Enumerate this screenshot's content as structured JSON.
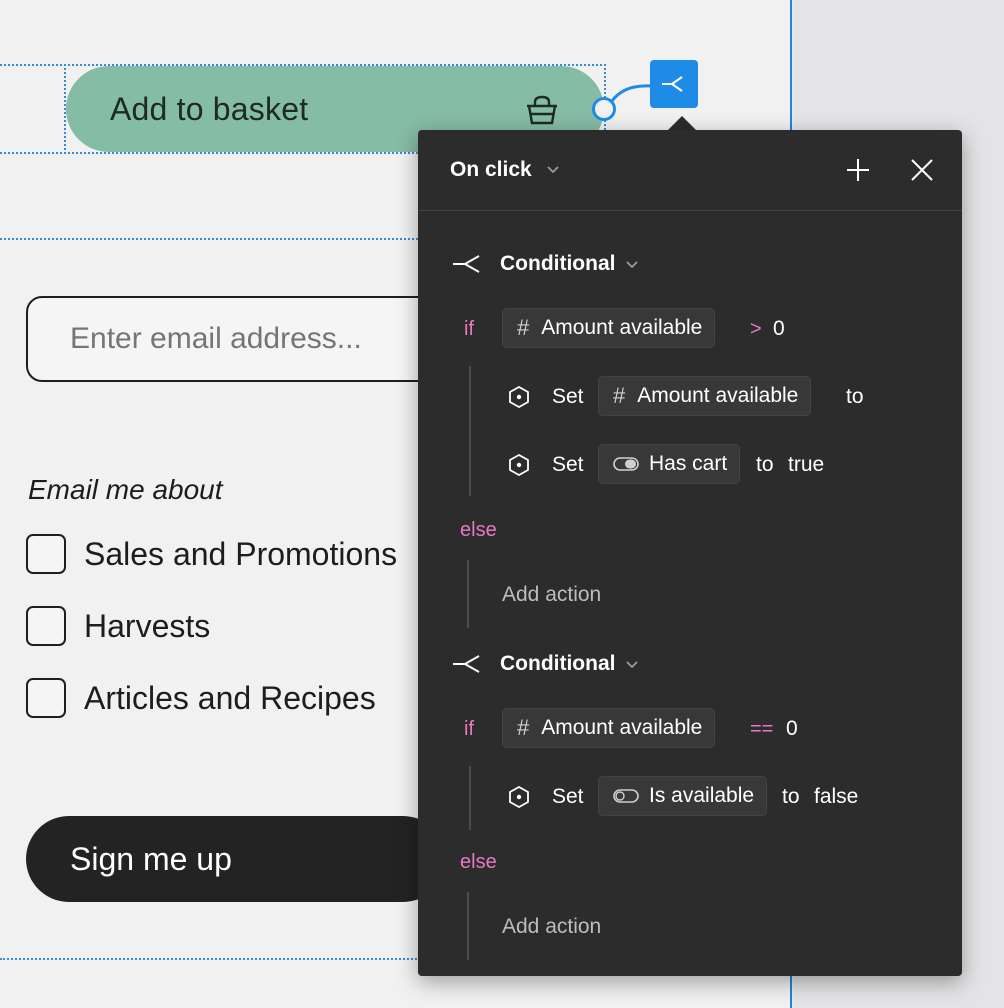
{
  "canvas": {
    "add_to_basket": "Add to basket",
    "email_placeholder": "Enter email address...",
    "email_label": "Email me about",
    "options": [
      "Sales and Promotions",
      "Harvests",
      "Articles and Recipes"
    ],
    "signup": "Sign me up",
    "frame_edge_color": "#1d86e0"
  },
  "panel": {
    "trigger": "On click",
    "conditional_1": {
      "label": "Conditional",
      "if": "if",
      "condition_var": "Amount available",
      "operator": ">",
      "value": "0",
      "actions": [
        {
          "verb": "Set",
          "var": "Amount available",
          "suffix": "to",
          "value": ""
        },
        {
          "verb": "Set",
          "var": "Has cart",
          "suffix": "to",
          "value": "true"
        }
      ],
      "else": "else",
      "add_action": "Add action"
    },
    "conditional_2": {
      "label": "Conditional",
      "if": "if",
      "condition_var": "Amount available",
      "operator": "==",
      "value": "0",
      "actions": [
        {
          "verb": "Set",
          "var": "Is available",
          "suffix": "to",
          "value": "false"
        }
      ],
      "else": "else",
      "add_action": "Add action"
    }
  },
  "icons": [
    "basket-icon",
    "trigger-icon",
    "chevron-down-icon",
    "plus-icon",
    "close-icon",
    "conditional-icon",
    "hash-icon",
    "toggle-icon",
    "hexagon-icon"
  ],
  "colors": {
    "accent": "#1e8be6",
    "button_green": "#85bca6",
    "panel_bg": "#2c2c2c",
    "keyword_pink": "#e679c4"
  }
}
